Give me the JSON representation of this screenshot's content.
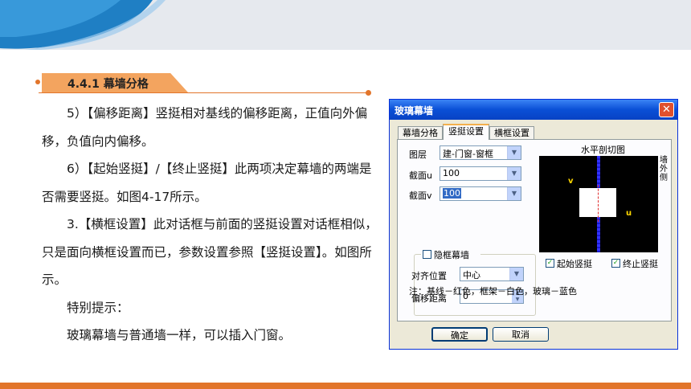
{
  "section": {
    "title": "4.4.1 幕墙分格"
  },
  "paragraphs": [
    "5）【偏移距离】竖挺相对基线的偏移距离，正值向外偏移，负值向内偏移。",
    "6）【起始竖挺】/【终止竖挺】此两项决定幕墙的两端是否需要竖挺。如图4-17所示。",
    "3.【横框设置】此对话框与前面的竖挺设置对话框相似，只是面向横框设置而已，参数设置参照【竖挺设置】。如图所示。",
    "特别提示：",
    "玻璃幕墙与普通墙一样，可以插入门窗。"
  ],
  "dialog": {
    "title": "玻璃幕墙",
    "close_symbol": "✕",
    "tabs": [
      "幕墙分格",
      "竖挺设置",
      "横框设置"
    ],
    "active_tab": 1,
    "fields": {
      "layer_label": "图层",
      "layer_value": "建-门窗-窗框",
      "section_u_label": "截面u",
      "section_u_value": "100",
      "section_v_label": "截面v",
      "section_v_value": "100",
      "hidden_frame_label": "隐框幕墙",
      "align_label": "对齐位置",
      "align_value": "中心",
      "offset_label": "偏移距离",
      "offset_value": "0"
    },
    "preview": {
      "title": "水平剖切图",
      "side_label": [
        "墙",
        "外",
        "侧"
      ],
      "u_label": "u",
      "v_label": "v"
    },
    "checks": {
      "start_label": "起始竖挺",
      "start_checked": true,
      "end_label": "终止竖挺",
      "end_checked": true
    },
    "note": "注：基线－红色，框架－白色，玻璃－蓝色",
    "ok_label": "确定",
    "cancel_label": "取消",
    "check_symbol": "✓",
    "arrow_symbol": "▼",
    "spin_up": "▲",
    "spin_down": "▼"
  },
  "colors": {
    "accent": "#e2752b",
    "tab_fill": "#f3a45f",
    "title_blue": "#0a4fd6"
  }
}
